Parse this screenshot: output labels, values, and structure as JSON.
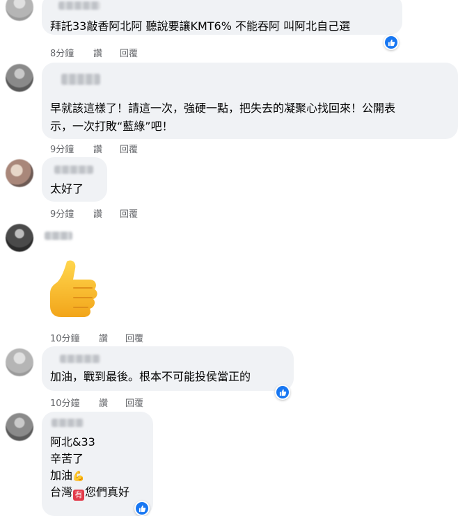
{
  "comments": [
    {
      "text_lines": [
        "拜託33敲香阿北阿 聽說要讓KMT6% 不能吞阿 叫阿北自己選"
      ],
      "time": "8分鐘",
      "like_label": "讚",
      "reply_label": "回覆",
      "reaction": "like"
    },
    {
      "text_lines": [
        "早就該這樣了！請這一次，強硬一點，把失去的凝聚心找回來！公開表",
        "示，一次打敗“藍綠”吧！"
      ],
      "time": "9分鐘",
      "like_label": "讚",
      "reply_label": "回覆"
    },
    {
      "text_lines": [
        "太好了"
      ],
      "time": "9分鐘",
      "like_label": "讚",
      "reply_label": "回覆"
    },
    {
      "sticker": "thumbs-up",
      "time": "10分鐘",
      "like_label": "讚",
      "reply_label": "回覆"
    },
    {
      "text_lines": [
        "加油，戰到最後。根本不可能投侯當正的"
      ],
      "time": "10分鐘",
      "like_label": "讚",
      "reply_label": "回覆",
      "reaction": "like"
    },
    {
      "text_lines": [
        "阿北&33",
        "辛苦了",
        "加油",
        "台灣",
        "您們真好"
      ],
      "emoji_flexed_biceps": "💪",
      "emoji_have_button": "有",
      "reaction": "like"
    }
  ],
  "colors": {
    "bubble": "#f0f2f5",
    "meta_text": "#65676b",
    "like_blue": "#1877f2"
  }
}
